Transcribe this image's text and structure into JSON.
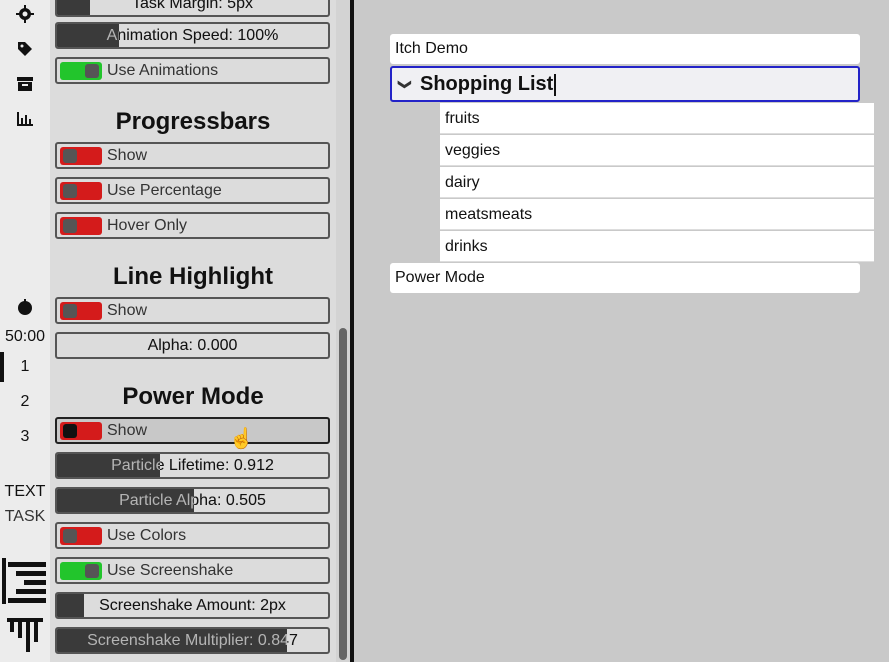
{
  "rail": {
    "icons": [
      "gear-icon",
      "tag-icon",
      "archive-icon",
      "bar-chart-icon",
      "pomodoro-icon"
    ],
    "timer": "50:00",
    "numbers": [
      "1",
      "2",
      "3"
    ],
    "modes": [
      "TEXT",
      "TASK"
    ]
  },
  "panel": {
    "top_sliders": [
      {
        "label": "Task Margin: 5px",
        "level": 0.12
      },
      {
        "label": "Animation Speed: 100%",
        "level": 0.23
      }
    ],
    "use_animations": {
      "label": "Use Animations",
      "on": true
    },
    "progressbars": {
      "heading": "Progressbars",
      "show": "Show",
      "use_percentage": "Use Percentage",
      "hover_only": "Hover Only"
    },
    "line_highlight": {
      "heading": "Line Highlight",
      "show": "Show",
      "alpha": "Alpha: 0.000"
    },
    "power_mode": {
      "heading": "Power Mode",
      "show": "Show",
      "particle_lifetime": {
        "label": "Particle Lifetime: 0.912",
        "level": 0.38
      },
      "particle_alpha": {
        "label": "Particle Alpha: 0.505",
        "level": 0.505
      },
      "use_colors": "Use Colors",
      "use_screenshake": "Use Screenshake",
      "screenshake_amount": {
        "label": "Screenshake Amount: 2px",
        "level": 0.1
      },
      "screenshake_multiplier": {
        "label": "Screenshake Multiplier: 0.847",
        "level": 0.847
      }
    }
  },
  "tree": {
    "item_1": "Itch Demo",
    "focused": "Shopping List",
    "children": [
      "fruits",
      "veggies",
      "dairy",
      "meatsmeats",
      "drinks"
    ],
    "item_3": "Power Mode"
  },
  "colors": {
    "toggle_on": "#22c52c",
    "toggle_off": "#d41b1b",
    "focus_border": "#2323c8"
  }
}
